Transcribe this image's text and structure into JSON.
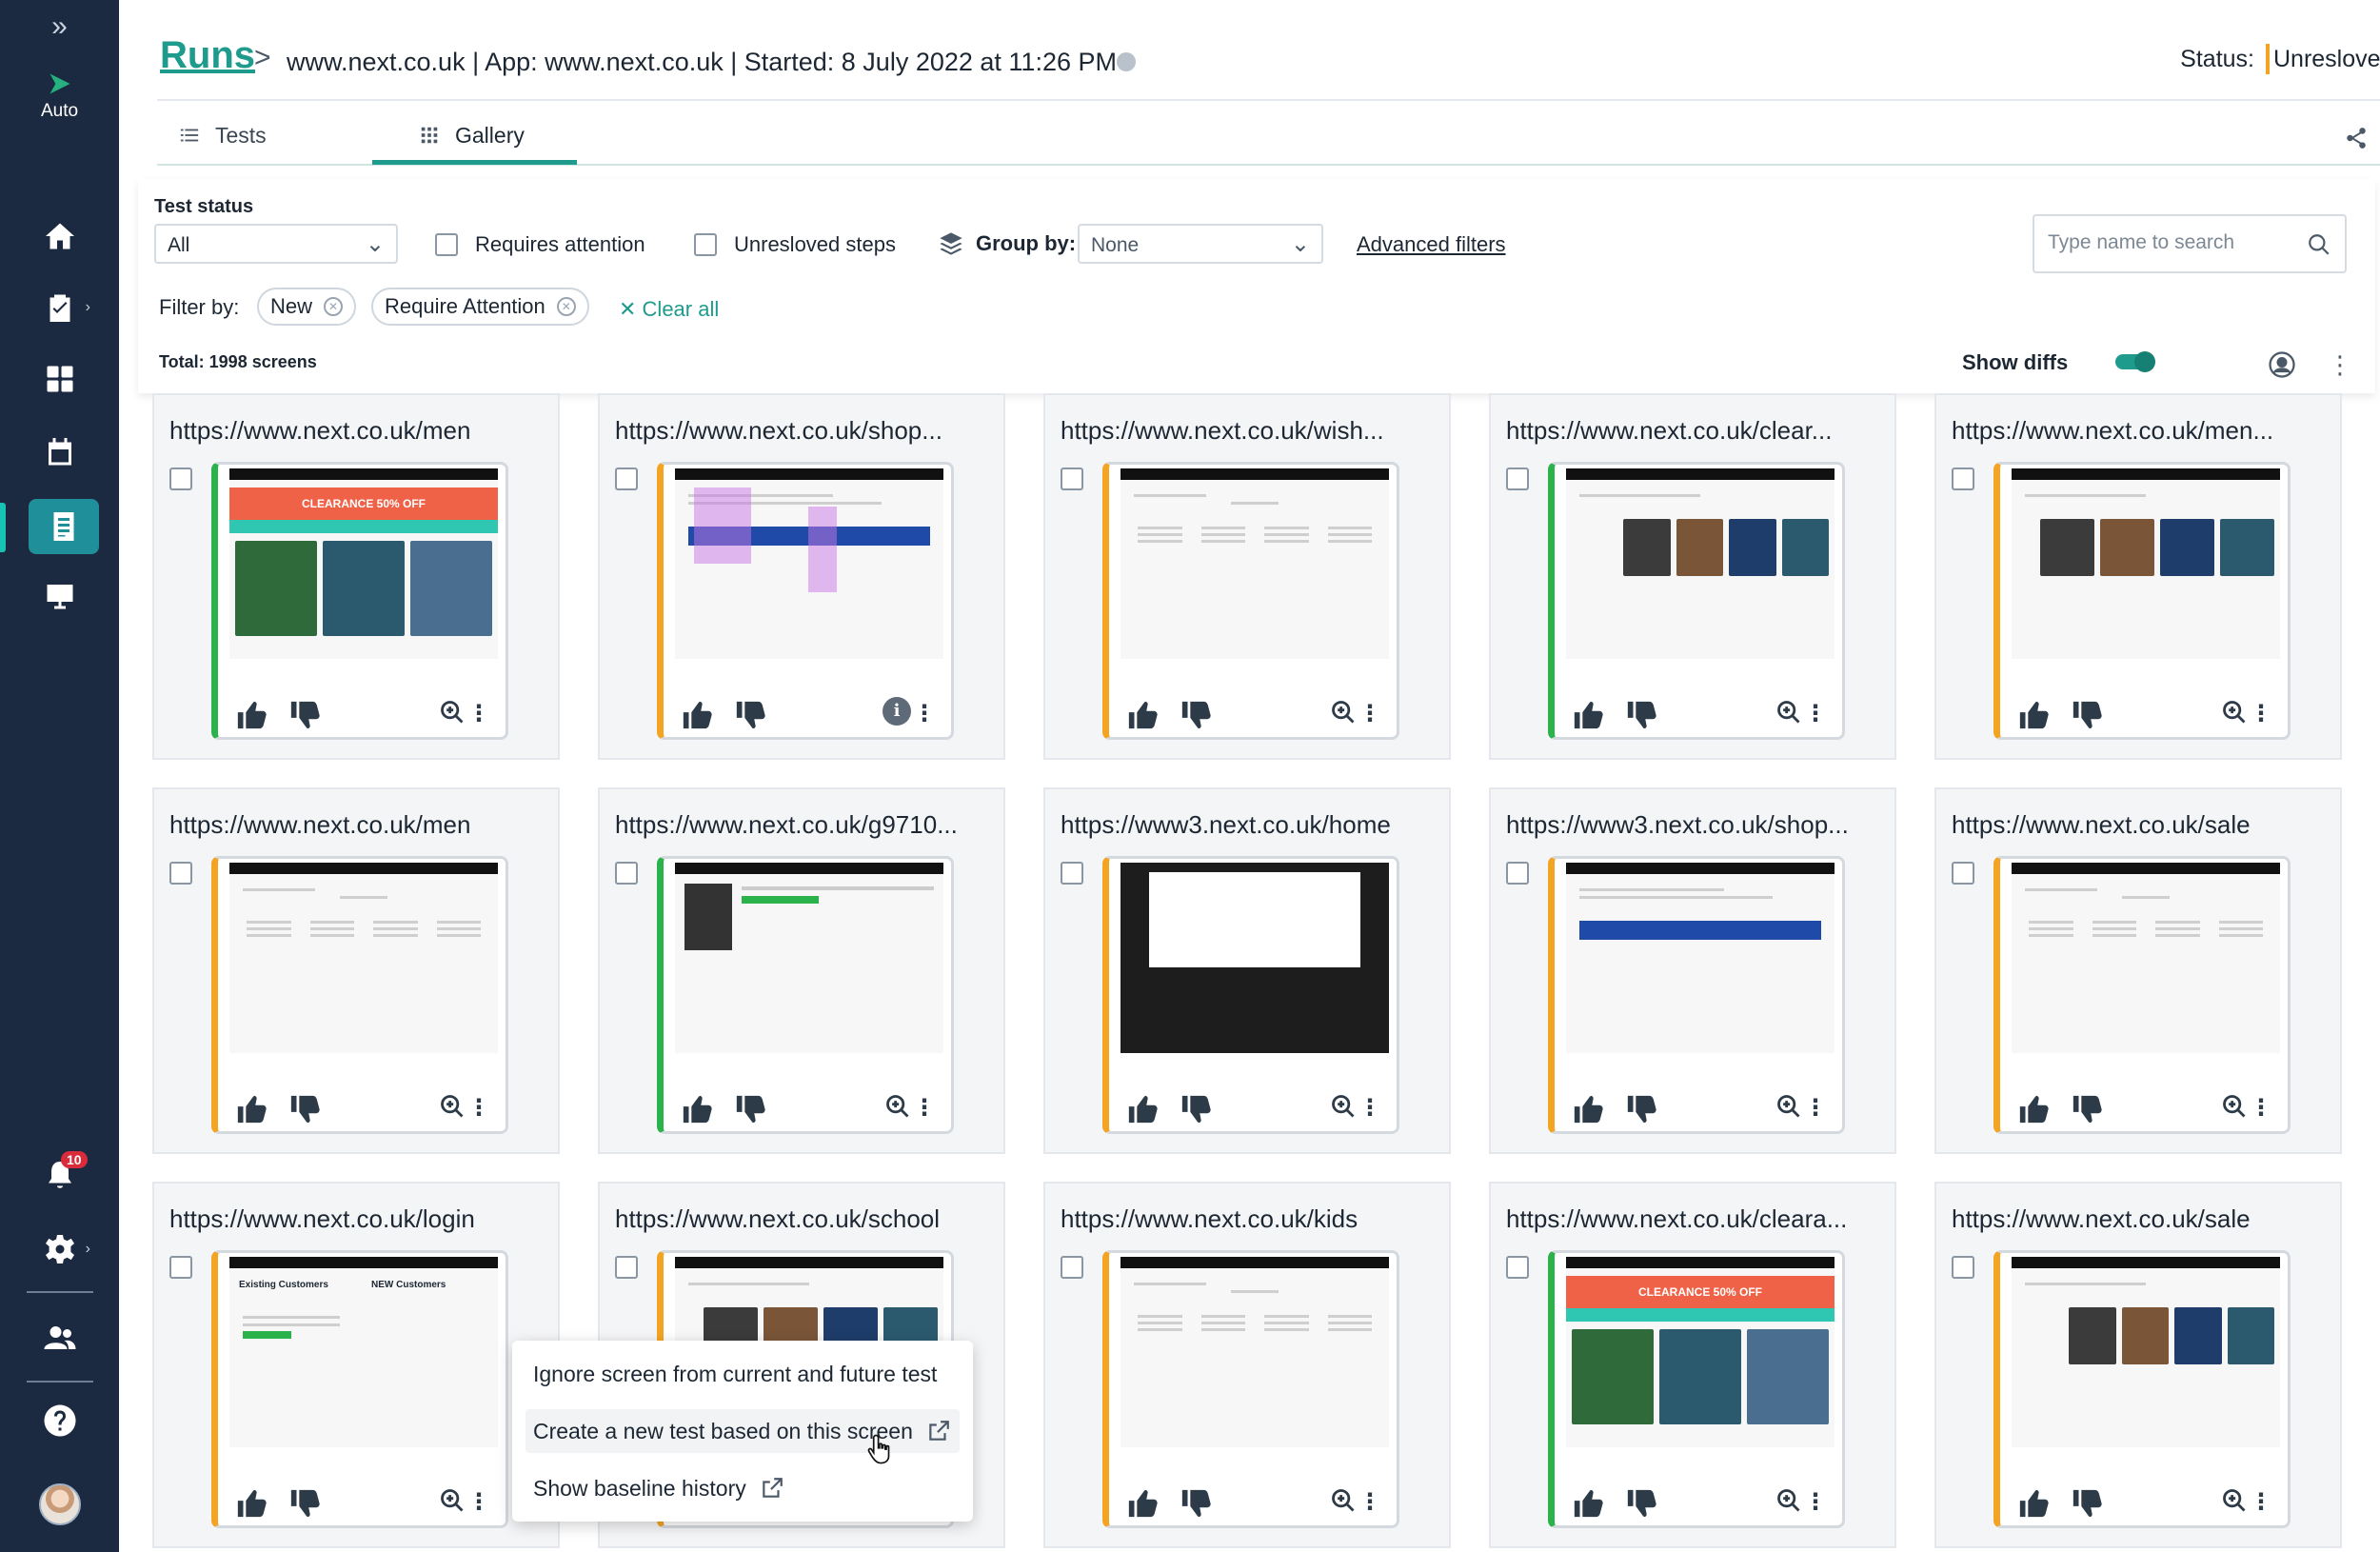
{
  "sidebar": {
    "expand_label": "»",
    "auto_label": "Auto",
    "notification_count": "10"
  },
  "header": {
    "runs_label": "Runs",
    "breadcrumb_sep": ">",
    "breadcrumb_text": "www.next.co.uk  | App: www.next.co.uk | Started: 8 July 2022 at 11:26 PM",
    "status_label": "Status:",
    "status_value": "Unresloved",
    "status_color": "#f4a423"
  },
  "tabs": [
    {
      "label": "Tests"
    },
    {
      "label": "Gallery"
    }
  ],
  "filters": {
    "test_status_label": "Test status",
    "test_status_value": "All",
    "requires_attention_label": "Requires attention",
    "unresolved_steps_label": "Unresloved steps",
    "group_by_label": "Group by:",
    "group_by_value": "None",
    "advanced_filters_label": "Advanced filters",
    "search_placeholder": "Type name to search",
    "filter_by_label": "Filter by:",
    "chips": [
      "New",
      "Require Attention"
    ],
    "clear_all_label": "Clear all",
    "total_label": "Total: 1998  screens",
    "show_diffs_label": "Show diffs"
  },
  "cards": [
    {
      "title": "https://www.next.co.uk/men"
    },
    {
      "title": "https://www.next.co.uk/shop..."
    },
    {
      "title": "https://www.next.co.uk/wish..."
    },
    {
      "title": "https://www.next.co.uk/clear..."
    },
    {
      "title": "https://www.next.co.uk/men..."
    },
    {
      "title": "https://www.next.co.uk/men"
    },
    {
      "title": "https://www.next.co.uk/g9710..."
    },
    {
      "title": "https://www3.next.co.uk/home"
    },
    {
      "title": "https://www3.next.co.uk/shop..."
    },
    {
      "title": "https://www.next.co.uk/sale"
    },
    {
      "title": "https://www.next.co.uk/login"
    },
    {
      "title": "https://www.next.co.uk/school"
    },
    {
      "title": "https://www.next.co.uk/kids"
    },
    {
      "title": "https://www.next.co.uk/cleara..."
    },
    {
      "title": "https://www.next.co.uk/sale"
    }
  ],
  "thumbnail_text": {
    "clearance": "CLEARANCE  50% OFF",
    "existing_customers": "Existing Customers",
    "new_customers": "NEW Customers"
  },
  "context_menu": {
    "ignore": "Ignore screen from current and future test",
    "create": "Create a new test based on this screen",
    "history": "Show baseline history"
  },
  "colors": {
    "accent": "#1f9b8e",
    "sidebar": "#1b2a41",
    "pending": "#f4a423",
    "passed": "#2cb24a"
  }
}
